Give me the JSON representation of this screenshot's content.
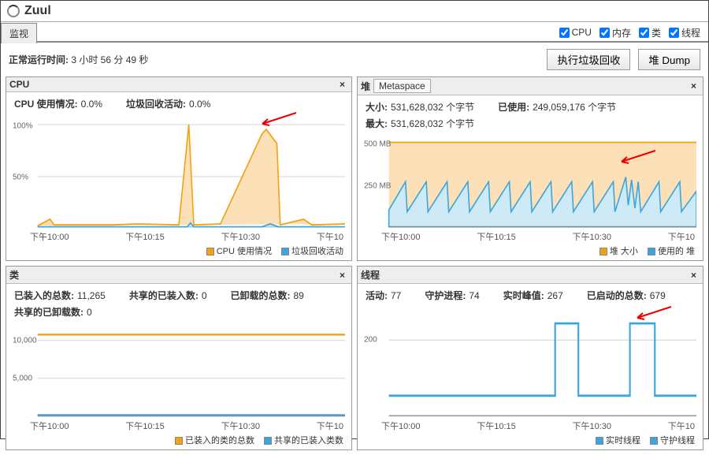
{
  "app": {
    "title": "Zuul"
  },
  "tabs": {
    "active": "监视"
  },
  "checks": {
    "cpu": "CPU",
    "mem": "内存",
    "cls": "类",
    "thr": "线程"
  },
  "uptime": {
    "label": "正常运行时间:",
    "value": "3 小时 56 分 49 秒"
  },
  "buttons": {
    "gc": "执行垃圾回收",
    "dump": "堆 Dump"
  },
  "colors": {
    "orange": "#f4a010",
    "blue": "#3aa6dd",
    "blueFill": "#cfeaf7",
    "orangeFill": "#fbe0b8"
  },
  "timeAxis": [
    "下午10:00",
    "下午10:15",
    "下午10:30",
    "下午10"
  ],
  "panels": {
    "cpu": {
      "title": "CPU",
      "info": [
        {
          "k": "CPU 使用情况:",
          "v": "0.0%"
        },
        {
          "k": "垃圾回收活动:",
          "v": "0.0%"
        }
      ],
      "legend": [
        {
          "c": "orange",
          "t": "CPU 使用情况"
        },
        {
          "c": "blue",
          "t": "垃圾回收活动"
        }
      ],
      "yticks": [
        "100%",
        "50%"
      ]
    },
    "heap": {
      "title": "堆",
      "tab": "Metaspace",
      "info": [
        {
          "k": "大小:",
          "v": "531,628,032 个字节"
        },
        {
          "k": "已使用:",
          "v": "249,059,176 个字节"
        },
        {
          "k": "最大:",
          "v": "531,628,032 个字节"
        }
      ],
      "legend": [
        {
          "c": "orange",
          "t": "堆 大小"
        },
        {
          "c": "blue",
          "t": "使用的 堆"
        }
      ],
      "yticks": [
        "500 MB",
        "250 MB"
      ]
    },
    "classes": {
      "title": "类",
      "info": [
        {
          "k": "已装入的总数:",
          "v": "11,265"
        },
        {
          "k": "共享的已装入数:",
          "v": "0"
        },
        {
          "k": "已卸载的总数:",
          "v": "89"
        },
        {
          "k": "共享的已卸载数:",
          "v": "0"
        }
      ],
      "legend": [
        {
          "c": "orange",
          "t": "已装入的类的总数"
        },
        {
          "c": "blue",
          "t": "共享的已装入类数"
        }
      ],
      "yticks": [
        "10,000",
        "5,000"
      ]
    },
    "threads": {
      "title": "线程",
      "info": [
        {
          "k": "活动:",
          "v": "77"
        },
        {
          "k": "守护进程:",
          "v": "74"
        },
        {
          "k": "实时峰值:",
          "v": "267"
        },
        {
          "k": "已启动的总数:",
          "v": "679"
        }
      ],
      "legend": [
        {
          "c": "blue",
          "t": "实时线程"
        },
        {
          "c": "blue",
          "t": "守护线程"
        }
      ],
      "yticks": [
        "200"
      ]
    }
  },
  "chart_data": [
    {
      "type": "line",
      "panel": "cpu",
      "series": [
        {
          "name": "CPU 使用情况",
          "x_range": [
            0,
            50
          ],
          "values_pct": "sparse spikes: ~7% at t=2, ~100% at t=25, ~95% at t=39-41, ~8% at t=46; baseline ~1-3%"
        },
        {
          "name": "垃圾回收活动",
          "x_range": [
            0,
            50
          ],
          "values_pct": "near 0% throughout; tiny bumps at t=25 and t=40"
        }
      ],
      "ylim": [
        0,
        100
      ],
      "yunit": "%"
    },
    {
      "type": "area",
      "panel": "heap",
      "series": [
        {
          "name": "堆 大小",
          "values_mb": "constant ≈ 500"
        },
        {
          "name": "使用的 堆",
          "values_mb": "sawtooth between ~130 and ~250, cycle ≈ 3 ticks; noisy burst around t=42-44"
        }
      ],
      "ylim": [
        0,
        520
      ],
      "yunit": "MB"
    },
    {
      "type": "line",
      "panel": "classes",
      "series": [
        {
          "name": "已装入的类的总数",
          "values": "constant ≈ 11265"
        },
        {
          "name": "共享的已装入类数",
          "values": "constant 0"
        }
      ],
      "ylim": [
        0,
        12000
      ]
    },
    {
      "type": "line",
      "panel": "threads",
      "series": [
        {
          "name": "实时线程",
          "values": "≈77 baseline; two rectangular spikes to ≈260 at t≈31-34 and t≈43-46"
        },
        {
          "name": "守护线程",
          "values": "≈74 baseline; overlaps实时"
        }
      ],
      "ylim": [
        0,
        280
      ]
    }
  ]
}
